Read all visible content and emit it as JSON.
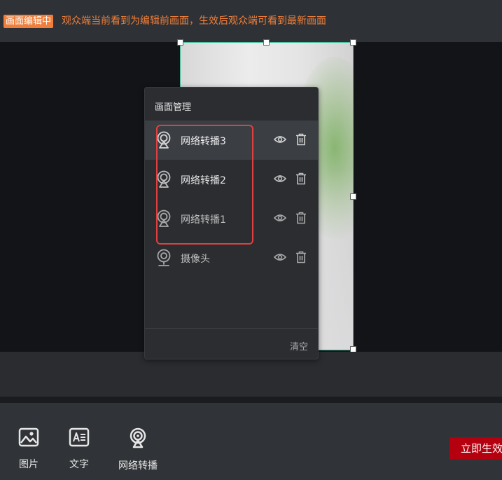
{
  "banner": {
    "badge": "画面编辑中",
    "notice": "观众端当前看到为编辑前画面，生效后观众端可看到最新画面"
  },
  "panel": {
    "title": "画面管理",
    "layers": [
      {
        "name": "网络转播3",
        "icon": "network-relay-icon",
        "active": true
      },
      {
        "name": "网络转播2",
        "icon": "network-relay-icon",
        "active": false
      },
      {
        "name": "网络转播1",
        "icon": "network-relay-icon",
        "active": false
      },
      {
        "name": "摄像头",
        "icon": "camera-icon",
        "active": false
      }
    ],
    "clear_label": "清空"
  },
  "toolbar": {
    "items": [
      {
        "label": "图片",
        "icon": "image-icon"
      },
      {
        "label": "文字",
        "icon": "text-icon"
      },
      {
        "label": "网络转播",
        "icon": "network-relay-icon"
      }
    ],
    "publish_label": "立即生效"
  },
  "colors": {
    "accent": "#f07f3b",
    "publish": "#b5000f",
    "highlight": "#e0403f",
    "selection": "#3fbf9a"
  }
}
